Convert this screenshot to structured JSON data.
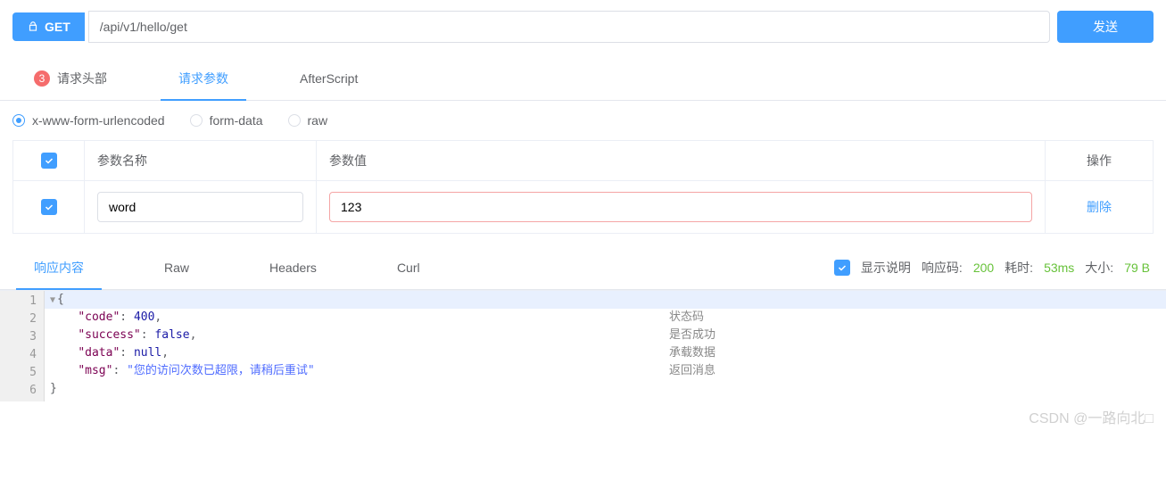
{
  "request": {
    "method": "GET",
    "url": "/api/v1/hello/get",
    "send_label": "发送"
  },
  "tabs": {
    "headers": {
      "label": "请求头部",
      "badge": "3"
    },
    "params": {
      "label": "请求参数"
    },
    "afterscript": {
      "label": "AfterScript"
    }
  },
  "body_types": {
    "urlencoded": "x-www-form-urlencoded",
    "formdata": "form-data",
    "raw": "raw"
  },
  "param_table": {
    "col_name": "参数名称",
    "col_value": "参数值",
    "col_op": "操作",
    "rows": [
      {
        "name": "word",
        "value": "123",
        "op": "删除"
      }
    ]
  },
  "response_tabs": {
    "content": "响应内容",
    "raw": "Raw",
    "headers": "Headers",
    "curl": "Curl"
  },
  "response_meta": {
    "show_desc_label": "显示说明",
    "code_label": "响应码:",
    "code_value": "200",
    "time_label": "耗时:",
    "time_value": "53ms",
    "size_label": "大小:",
    "size_value": "79 B"
  },
  "response_body": {
    "lines": [
      "1",
      "2",
      "3",
      "4",
      "5",
      "6"
    ],
    "l1": "{",
    "l2_key": "\"code\"",
    "l2_sep": ": ",
    "l2_val": "400",
    "l2_end": ",",
    "l3_key": "\"success\"",
    "l3_val": "false",
    "l3_end": ",",
    "l4_key": "\"data\"",
    "l4_val": "null",
    "l4_end": ",",
    "l5_key": "\"msg\"",
    "l5_val": "\"您的访问次数已超限，请稍后重试\"",
    "l6": "}",
    "comments": {
      "c2": "状态码",
      "c3": "是否成功",
      "c4": "承载数据",
      "c5": "返回消息"
    }
  },
  "watermark": "CSDN @一路向北□"
}
